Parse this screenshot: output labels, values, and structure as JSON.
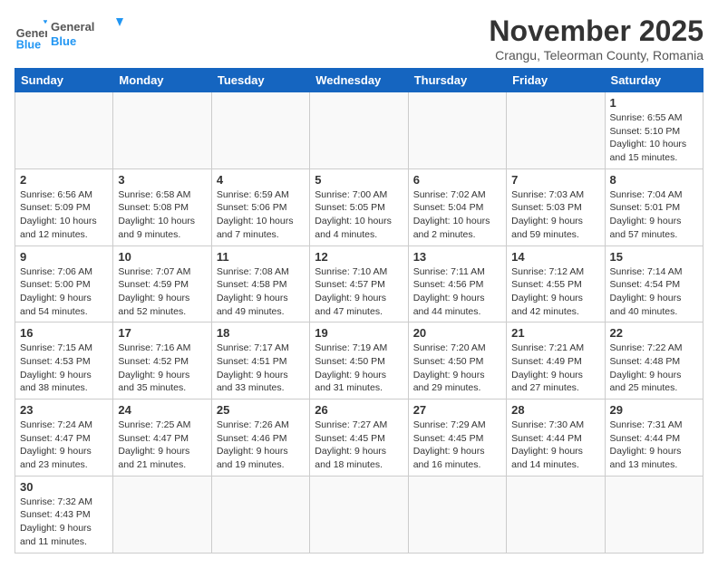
{
  "header": {
    "logo_general": "General",
    "logo_blue": "Blue",
    "month_title": "November 2025",
    "location": "Crangu, Teleorman County, Romania"
  },
  "days_of_week": [
    "Sunday",
    "Monday",
    "Tuesday",
    "Wednesday",
    "Thursday",
    "Friday",
    "Saturday"
  ],
  "weeks": [
    [
      {
        "day": "",
        "info": ""
      },
      {
        "day": "",
        "info": ""
      },
      {
        "day": "",
        "info": ""
      },
      {
        "day": "",
        "info": ""
      },
      {
        "day": "",
        "info": ""
      },
      {
        "day": "",
        "info": ""
      },
      {
        "day": "1",
        "info": "Sunrise: 6:55 AM\nSunset: 5:10 PM\nDaylight: 10 hours and 15 minutes."
      }
    ],
    [
      {
        "day": "2",
        "info": "Sunrise: 6:56 AM\nSunset: 5:09 PM\nDaylight: 10 hours and 12 minutes."
      },
      {
        "day": "3",
        "info": "Sunrise: 6:58 AM\nSunset: 5:08 PM\nDaylight: 10 hours and 9 minutes."
      },
      {
        "day": "4",
        "info": "Sunrise: 6:59 AM\nSunset: 5:06 PM\nDaylight: 10 hours and 7 minutes."
      },
      {
        "day": "5",
        "info": "Sunrise: 7:00 AM\nSunset: 5:05 PM\nDaylight: 10 hours and 4 minutes."
      },
      {
        "day": "6",
        "info": "Sunrise: 7:02 AM\nSunset: 5:04 PM\nDaylight: 10 hours and 2 minutes."
      },
      {
        "day": "7",
        "info": "Sunrise: 7:03 AM\nSunset: 5:03 PM\nDaylight: 9 hours and 59 minutes."
      },
      {
        "day": "8",
        "info": "Sunrise: 7:04 AM\nSunset: 5:01 PM\nDaylight: 9 hours and 57 minutes."
      }
    ],
    [
      {
        "day": "9",
        "info": "Sunrise: 7:06 AM\nSunset: 5:00 PM\nDaylight: 9 hours and 54 minutes."
      },
      {
        "day": "10",
        "info": "Sunrise: 7:07 AM\nSunset: 4:59 PM\nDaylight: 9 hours and 52 minutes."
      },
      {
        "day": "11",
        "info": "Sunrise: 7:08 AM\nSunset: 4:58 PM\nDaylight: 9 hours and 49 minutes."
      },
      {
        "day": "12",
        "info": "Sunrise: 7:10 AM\nSunset: 4:57 PM\nDaylight: 9 hours and 47 minutes."
      },
      {
        "day": "13",
        "info": "Sunrise: 7:11 AM\nSunset: 4:56 PM\nDaylight: 9 hours and 44 minutes."
      },
      {
        "day": "14",
        "info": "Sunrise: 7:12 AM\nSunset: 4:55 PM\nDaylight: 9 hours and 42 minutes."
      },
      {
        "day": "15",
        "info": "Sunrise: 7:14 AM\nSunset: 4:54 PM\nDaylight: 9 hours and 40 minutes."
      }
    ],
    [
      {
        "day": "16",
        "info": "Sunrise: 7:15 AM\nSunset: 4:53 PM\nDaylight: 9 hours and 38 minutes."
      },
      {
        "day": "17",
        "info": "Sunrise: 7:16 AM\nSunset: 4:52 PM\nDaylight: 9 hours and 35 minutes."
      },
      {
        "day": "18",
        "info": "Sunrise: 7:17 AM\nSunset: 4:51 PM\nDaylight: 9 hours and 33 minutes."
      },
      {
        "day": "19",
        "info": "Sunrise: 7:19 AM\nSunset: 4:50 PM\nDaylight: 9 hours and 31 minutes."
      },
      {
        "day": "20",
        "info": "Sunrise: 7:20 AM\nSunset: 4:50 PM\nDaylight: 9 hours and 29 minutes."
      },
      {
        "day": "21",
        "info": "Sunrise: 7:21 AM\nSunset: 4:49 PM\nDaylight: 9 hours and 27 minutes."
      },
      {
        "day": "22",
        "info": "Sunrise: 7:22 AM\nSunset: 4:48 PM\nDaylight: 9 hours and 25 minutes."
      }
    ],
    [
      {
        "day": "23",
        "info": "Sunrise: 7:24 AM\nSunset: 4:47 PM\nDaylight: 9 hours and 23 minutes."
      },
      {
        "day": "24",
        "info": "Sunrise: 7:25 AM\nSunset: 4:47 PM\nDaylight: 9 hours and 21 minutes."
      },
      {
        "day": "25",
        "info": "Sunrise: 7:26 AM\nSunset: 4:46 PM\nDaylight: 9 hours and 19 minutes."
      },
      {
        "day": "26",
        "info": "Sunrise: 7:27 AM\nSunset: 4:45 PM\nDaylight: 9 hours and 18 minutes."
      },
      {
        "day": "27",
        "info": "Sunrise: 7:29 AM\nSunset: 4:45 PM\nDaylight: 9 hours and 16 minutes."
      },
      {
        "day": "28",
        "info": "Sunrise: 7:30 AM\nSunset: 4:44 PM\nDaylight: 9 hours and 14 minutes."
      },
      {
        "day": "29",
        "info": "Sunrise: 7:31 AM\nSunset: 4:44 PM\nDaylight: 9 hours and 13 minutes."
      }
    ],
    [
      {
        "day": "30",
        "info": "Sunrise: 7:32 AM\nSunset: 4:43 PM\nDaylight: 9 hours and 11 minutes."
      },
      {
        "day": "",
        "info": ""
      },
      {
        "day": "",
        "info": ""
      },
      {
        "day": "",
        "info": ""
      },
      {
        "day": "",
        "info": ""
      },
      {
        "day": "",
        "info": ""
      },
      {
        "day": "",
        "info": ""
      }
    ]
  ]
}
